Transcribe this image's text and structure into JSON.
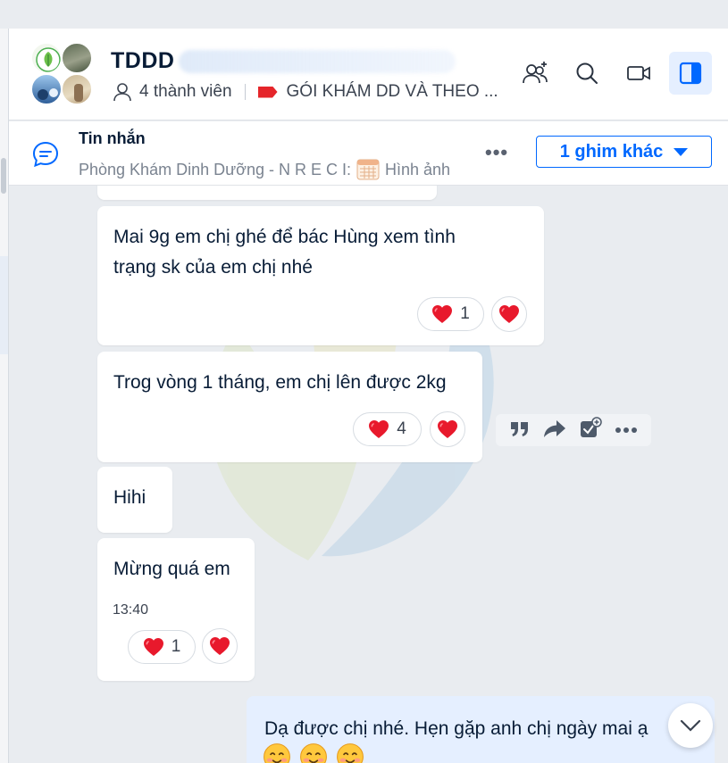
{
  "header": {
    "title": "TDDD",
    "member_count": "4 thành viên",
    "label_tag": "GÓI KHÁM DD VÀ THEO ...",
    "actions": [
      {
        "icon": "add-member-icon"
      },
      {
        "icon": "search-icon"
      },
      {
        "icon": "video-call-icon"
      },
      {
        "icon": "side-panel-icon",
        "active": true
      }
    ]
  },
  "pinned": {
    "title": "Tin nhắn",
    "text_prefix": "Phòng Khám Dinh Dưỡng - N R E C I:",
    "text_suffix": "Hình ảnh",
    "more_label": "•••",
    "other_pins_button": "1 ghim khác"
  },
  "messages": [
    {
      "text_line1": "Mai 9g em chị ghé để bác Hùng xem tình",
      "text_line2": "trạng sk của em chị nhé",
      "reaction_count": "1"
    },
    {
      "text": "Trog vòng 1 tháng, em chị lên được 2kg",
      "reaction_count": "4"
    },
    {
      "text": "Hihi"
    },
    {
      "text": "Mừng quá em",
      "time": "13:40",
      "reaction_count": "1"
    }
  ],
  "hover_actions": [
    {
      "icon": "quote-icon"
    },
    {
      "icon": "forward-icon"
    },
    {
      "icon": "add-task-icon"
    },
    {
      "icon": "more-icon"
    }
  ],
  "sent_message": {
    "text": "Dạ được chị nhé. Hẹn gặp anh chị ngày mai ạ"
  },
  "colors": {
    "accent": "#0068ff",
    "sent_bubble": "#e5efff",
    "chat_bg": "#e9ecf0",
    "heart": "#e8192c"
  }
}
